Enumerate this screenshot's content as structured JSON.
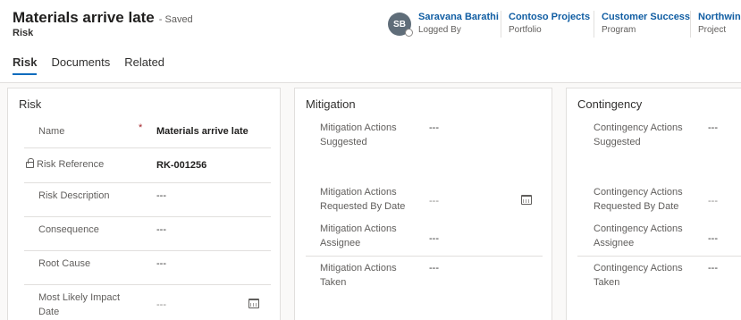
{
  "header": {
    "title": "Materials arrive late",
    "saved_status": "- Saved",
    "entity": "Risk",
    "owner": {
      "initials": "SB",
      "name": "Saravana Barathi",
      "label": "Logged By"
    },
    "fields": [
      {
        "value": "Contoso Projects",
        "label": "Portfolio"
      },
      {
        "value": "Customer Success",
        "label": "Program"
      },
      {
        "value": "Northwind",
        "label": "Project"
      }
    ]
  },
  "tabs": [
    {
      "label": "Risk"
    },
    {
      "label": "Documents"
    },
    {
      "label": "Related"
    }
  ],
  "risk": {
    "title": "Risk",
    "name": {
      "label": "Name",
      "required": "*",
      "value": "Materials arrive late"
    },
    "reference": {
      "label": "Risk Reference",
      "value": "RK-001256"
    },
    "description": {
      "label": "Risk Description",
      "value": "---"
    },
    "consequence": {
      "label": "Consequence",
      "value": "---"
    },
    "root_cause": {
      "label": "Root Cause",
      "value": "---"
    },
    "impact_date": {
      "label": "Most Likely Impact",
      "label2": "Date",
      "value": "---"
    }
  },
  "mitigation": {
    "title": "Mitigation",
    "suggested": {
      "label": "Mitigation Actions",
      "label2": "Suggested",
      "value": "---"
    },
    "requested_by": {
      "label": "Mitigation Actions",
      "label2": "Requested By Date",
      "value": "---"
    },
    "assignee": {
      "label": "Mitigation Actions",
      "label2": "Assignee",
      "value": "---"
    },
    "taken": {
      "label": "Mitigation Actions",
      "label2": "Taken",
      "value": "---"
    }
  },
  "contingency": {
    "title": "Contingency",
    "suggested": {
      "label": "Contingency Actions",
      "label2": "Suggested",
      "value": "---"
    },
    "requested_by": {
      "label": "Contingency Actions",
      "label2": "Requested By Date",
      "value": "---"
    },
    "assignee": {
      "label": "Contingency Actions",
      "label2": "Assignee",
      "value": "---"
    },
    "taken": {
      "label": "Contingency Actions",
      "label2": "Taken",
      "value": "---"
    }
  }
}
